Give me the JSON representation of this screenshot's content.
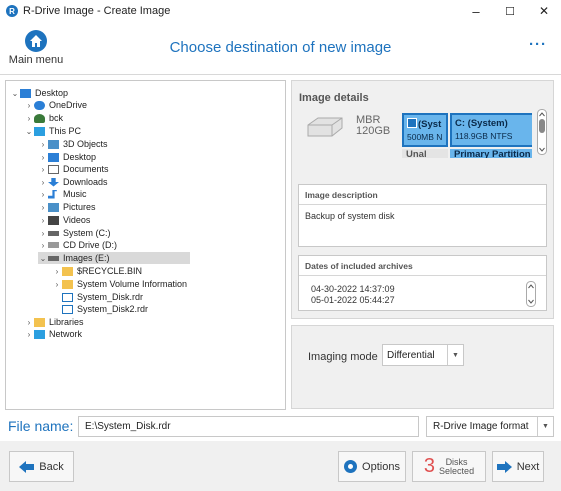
{
  "window": {
    "title": "R-Drive Image - Create Image",
    "minimize": "–",
    "maximize": "☐",
    "close": "✕"
  },
  "header": {
    "home_label": "Main menu",
    "title": "Choose destination of new image",
    "more": "···"
  },
  "tree": {
    "items": [
      {
        "label": "Desktop",
        "expander": "⌄",
        "icon": "desktop-folder-icon"
      },
      {
        "label": "OneDrive",
        "expander": "›",
        "icon": "cloud-icon"
      },
      {
        "label": "bck",
        "expander": "›",
        "icon": "user-icon"
      },
      {
        "label": "This PC",
        "expander": "⌄",
        "icon": "computer-icon"
      },
      {
        "label": "3D Objects",
        "expander": "›",
        "icon": "cube-icon"
      },
      {
        "label": "Desktop",
        "expander": "›",
        "icon": "desktop-folder-icon"
      },
      {
        "label": "Documents",
        "expander": "›",
        "icon": "document-icon"
      },
      {
        "label": "Downloads",
        "expander": "›",
        "icon": "download-icon"
      },
      {
        "label": "Music",
        "expander": "›",
        "icon": "music-icon"
      },
      {
        "label": "Pictures",
        "expander": "›",
        "icon": "picture-icon"
      },
      {
        "label": "Videos",
        "expander": "›",
        "icon": "video-icon"
      },
      {
        "label": "System (C:)",
        "expander": "›",
        "icon": "drive-icon"
      },
      {
        "label": "CD Drive (D:)",
        "expander": "›",
        "icon": "cd-icon"
      },
      {
        "label": "Images (E:)",
        "expander": "⌄",
        "icon": "drive-icon",
        "selected": true
      },
      {
        "label": "$RECYCLE.BIN",
        "expander": "›",
        "icon": "folder-icon"
      },
      {
        "label": "System Volume Information",
        "expander": "›",
        "icon": "folder-icon"
      },
      {
        "label": "System_Disk.rdr",
        "expander": "",
        "icon": "image-file-icon"
      },
      {
        "label": "System_Disk2.rdr",
        "expander": "",
        "icon": "image-file-icon"
      },
      {
        "label": "Libraries",
        "expander": "›",
        "icon": "library-icon"
      },
      {
        "label": "Network",
        "expander": "›",
        "icon": "network-icon"
      }
    ]
  },
  "details": {
    "title": "Image details",
    "disk_type": "MBR",
    "disk_size": "120GB",
    "partitions": [
      {
        "name": "(Syst",
        "size": "500MB N",
        "type": "Unal"
      },
      {
        "name": "C: (System)",
        "size": "118.9GB NTFS",
        "type": "Primary Partition"
      }
    ]
  },
  "description": {
    "title": "Image description",
    "text": "Backup of system disk"
  },
  "archives": {
    "title": "Dates of included archives",
    "dates": [
      "04-30-2022 14:37:09",
      "05-01-2022 05:44:27"
    ]
  },
  "imaging": {
    "label": "Imaging mode",
    "value": "Differential"
  },
  "file": {
    "label": "File name:",
    "value": "E:\\System_Disk.rdr",
    "format": "R-Drive Image format"
  },
  "footer": {
    "back": "Back",
    "options": "Options",
    "disks_count": "3",
    "disks_line1": "Disks",
    "disks_line2": "Selected",
    "next": "Next"
  },
  "colors": {
    "accent": "#1e73be",
    "partition_fill": "#69b5ec",
    "panel_bg": "#f0f0f0",
    "disks_count": "#e05050"
  }
}
